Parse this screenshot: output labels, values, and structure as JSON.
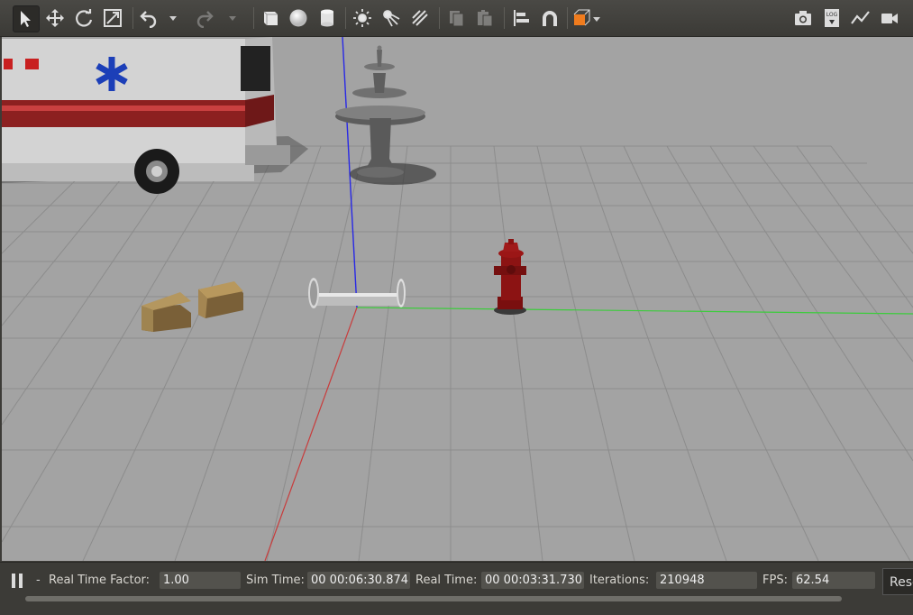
{
  "toolbar": {
    "tools": [
      {
        "name": "select-mode-icon"
      },
      {
        "name": "translate-mode-icon"
      },
      {
        "name": "rotate-mode-icon"
      },
      {
        "name": "scale-mode-icon"
      },
      {
        "name": "undo-icon"
      },
      {
        "name": "undo-history-icon"
      },
      {
        "name": "redo-icon"
      },
      {
        "name": "redo-history-icon"
      },
      {
        "name": "box-shape-icon"
      },
      {
        "name": "sphere-shape-icon"
      },
      {
        "name": "cylinder-shape-icon"
      },
      {
        "name": "point-light-icon"
      },
      {
        "name": "spot-light-icon"
      },
      {
        "name": "directional-light-icon"
      },
      {
        "name": "copy-icon"
      },
      {
        "name": "paste-icon"
      },
      {
        "name": "align-icon"
      },
      {
        "name": "snap-icon"
      },
      {
        "name": "view-angle-icon"
      },
      {
        "name": "screenshot-icon"
      },
      {
        "name": "log-icon"
      },
      {
        "name": "plot-icon"
      },
      {
        "name": "video-record-icon"
      }
    ],
    "log_label": "LOG",
    "accent_color": "#f07c1e"
  },
  "status": {
    "dash": "-",
    "rtf_label": "Real Time Factor:",
    "rtf_value": "1.00",
    "sim_label": "Sim Time:",
    "sim_value": "00 00:06:30.874",
    "real_label": "Real Time:",
    "real_value": "00 00:03:31.730",
    "iter_label": "Iterations:",
    "iter_value": "210948",
    "fps_label": "FPS:",
    "fps_value": "62.54",
    "reset_label": "Reset"
  },
  "scene": {
    "ground_color": "#a3a3a3",
    "objects": [
      "ambulance",
      "fountain",
      "cardboard-box-1",
      "cardboard-box-2",
      "cylinder-robot",
      "fire-hydrant"
    ],
    "axis_colors": {
      "x": "#c83c3c",
      "y": "#3ccc3c",
      "z": "#2828e6"
    }
  }
}
